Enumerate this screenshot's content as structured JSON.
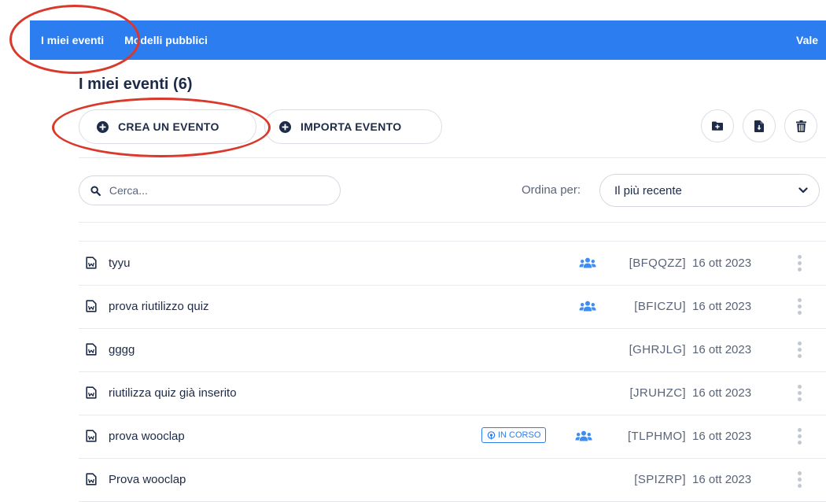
{
  "nav": {
    "my_events": "I miei eventi",
    "public_models": "Modelli pubblici",
    "user": "Vale"
  },
  "page": {
    "title": "I miei eventi (6)"
  },
  "actions": {
    "create_event": "CREA UN EVENTO",
    "import_event": "IMPORTA EVENTO",
    "icons": [
      "folder-plus-icon",
      "file-export-icon",
      "trash-icon"
    ]
  },
  "search": {
    "placeholder": "Cerca..."
  },
  "sort": {
    "label": "Ordina per:",
    "selected": "Il più recente"
  },
  "events": [
    {
      "title": "tyyu",
      "code": "[BFQQZZ]",
      "date": "16 ott 2023",
      "badge": "",
      "group": true
    },
    {
      "title": "prova riutilizzo quiz",
      "code": "[BFICZU]",
      "date": "16 ott 2023",
      "badge": "",
      "group": true
    },
    {
      "title": "gggg",
      "code": "[GHRJLG]",
      "date": "16 ott 2023",
      "badge": "",
      "group": false
    },
    {
      "title": "riutilizza quiz già inserito",
      "code": "[JRUHZC]",
      "date": "16 ott 2023",
      "badge": "",
      "group": false
    },
    {
      "title": "prova wooclap",
      "code": "[TLPHMO]",
      "date": "16 ott 2023",
      "badge": "IN CORSO",
      "group": true
    },
    {
      "title": "Prova wooclap",
      "code": "[SPIZRP]",
      "date": "16 ott 2023",
      "badge": "",
      "group": false
    }
  ],
  "colors": {
    "primary": "#2c7df0",
    "text": "#1d2b48",
    "muted": "#5a6478",
    "annotation": "#d9382a"
  }
}
